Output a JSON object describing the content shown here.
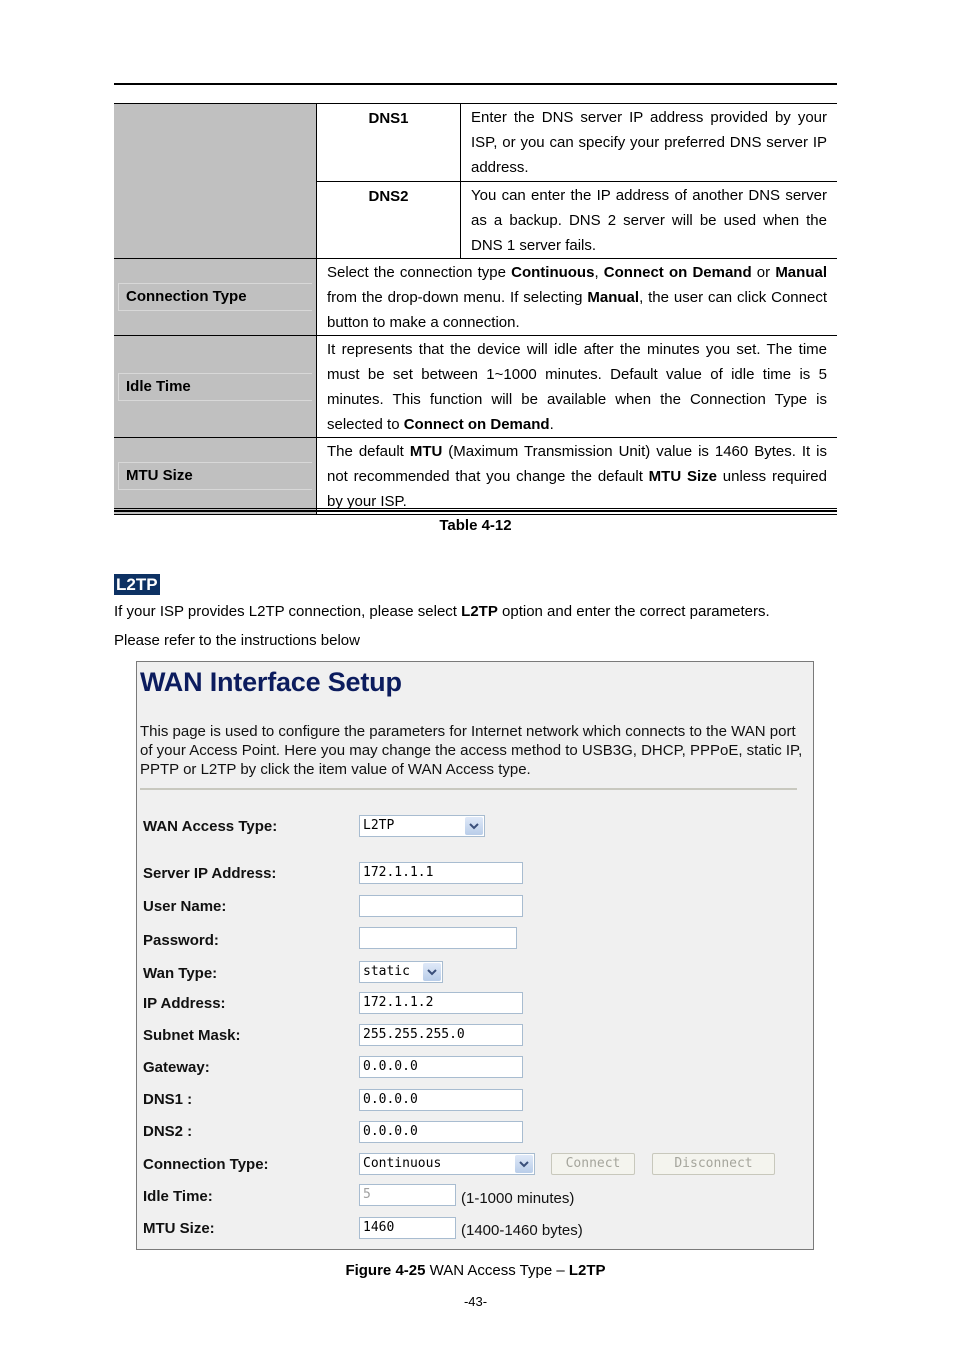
{
  "table": {
    "rows": [
      {
        "label": "",
        "subrows": [
          {
            "name": "DNS1",
            "description": "Enter the DNS server IP address provided by your ISP, or you can specify your preferred DNS server IP address."
          },
          {
            "name": "DNS2",
            "description": "You can enter the IP address of another DNS server as a backup. DNS 2 server will be used when the DNS 1 server fails."
          }
        ]
      },
      {
        "label": "Connection Type",
        "description_parts": [
          "Select the connection type ",
          "Continuous",
          ", ",
          "Connect on Demand",
          " or ",
          "Manual",
          " from the drop-down menu. If selecting ",
          "Manual",
          ", the user can click Connect button to make a connection."
        ]
      },
      {
        "label": "Idle Time",
        "description_parts": [
          "It represents that the device will idle after the minutes you set. The time must be set between 1~1000 minutes. Default value of idle time is 5 minutes. This function will be available when the Connection Type is selected to ",
          "Connect on Demand",
          "."
        ]
      },
      {
        "label": "MTU Size",
        "description_parts": [
          "The default ",
          "MTU",
          " (Maximum Transmission Unit) value is 1460 Bytes. It is not recommended that you change the default ",
          "MTU Size",
          " unless required by your ISP."
        ]
      }
    ],
    "caption": "Table 4-12"
  },
  "section": {
    "tag": "L2TP",
    "tag_color": "#0d3163",
    "intro_parts": [
      "If your ISP provides L2TP connection, please select ",
      "L2TP",
      " option and enter the correct parameters."
    ],
    "intro_line2": "Please refer to the instructions below"
  },
  "screenshot": {
    "title": "WAN Interface Setup",
    "description": "This page is used to configure the parameters for Internet network which connects to the WAN port of your Access Point. Here you may change the access method to USB3G, DHCP, PPPoE, static IP, PPTP or L2TP by click the item value of WAN Access type.",
    "fields": {
      "wan_access_type": {
        "label": "WAN Access Type:",
        "value": "L2TP"
      },
      "server_ip": {
        "label": "Server IP Address:",
        "value": "172.1.1.1"
      },
      "user_name": {
        "label": "User Name:",
        "value": ""
      },
      "password": {
        "label": "Password:",
        "value": ""
      },
      "wan_type": {
        "label": "Wan Type:",
        "value": "static"
      },
      "ip_address": {
        "label": "IP Address:",
        "value": "172.1.1.2"
      },
      "subnet_mask": {
        "label": "Subnet Mask:",
        "value": "255.255.255.0"
      },
      "gateway": {
        "label": "Gateway:",
        "value": "0.0.0.0"
      },
      "dns1": {
        "label": "DNS1 :",
        "value": "0.0.0.0"
      },
      "dns2": {
        "label": "DNS2 :",
        "value": "0.0.0.0"
      },
      "connection_type": {
        "label": "Connection Type:",
        "value": "Continuous"
      },
      "idle_time": {
        "label": "Idle Time:",
        "value": "5",
        "hint": "(1-1000 minutes)"
      },
      "mtu_size": {
        "label": "MTU Size:",
        "value": "1460",
        "hint": "(1400-1460 bytes)"
      }
    },
    "buttons": {
      "connect": "Connect",
      "disconnect": "Disconnect"
    },
    "title_color": "#0c1c5e"
  },
  "figure_caption": {
    "prefix": "Figure 4-25",
    "middle": " WAN Access Type – ",
    "suffix": "L2TP"
  },
  "page_number": "-43-"
}
